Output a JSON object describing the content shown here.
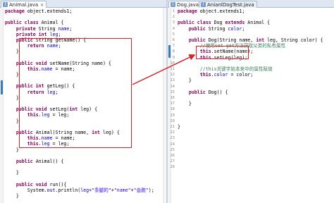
{
  "left_editor": {
    "tab_active": "Animal.java",
    "tab_inactive": "Dog.java",
    "lines": [
      [
        [
          "kw",
          "package"
        ],
        [
          "t",
          " object.extends1;"
        ]
      ],
      [],
      [
        [
          "kw",
          "public class"
        ],
        [
          "t",
          " Animal {"
        ]
      ],
      [
        [
          "t",
          "    "
        ],
        [
          "kw",
          "private"
        ],
        [
          "t",
          " String "
        ],
        [
          "fld",
          "name"
        ],
        [
          "t",
          ";"
        ]
      ],
      [
        [
          "t",
          "    "
        ],
        [
          "kw",
          "private int"
        ],
        [
          "t",
          " "
        ],
        [
          "fld",
          "leg"
        ],
        [
          "t",
          ";"
        ]
      ],
      [
        [
          "t",
          "    "
        ],
        [
          "kw",
          "public"
        ],
        [
          "t",
          " String getName() {"
        ]
      ],
      [
        [
          "t",
          "        "
        ],
        [
          "kw",
          "return"
        ],
        [
          "t",
          " "
        ],
        [
          "fld",
          "name"
        ],
        [
          "t",
          ";"
        ]
      ],
      [
        [
          "t",
          "    }"
        ]
      ],
      [],
      [
        [
          "t",
          "    "
        ],
        [
          "kw",
          "public void"
        ],
        [
          "t",
          " setName(String name) {"
        ]
      ],
      [
        [
          "t",
          "        "
        ],
        [
          "kw",
          "this"
        ],
        [
          "t",
          "."
        ],
        [
          "fld",
          "name"
        ],
        [
          "t",
          " = name;"
        ]
      ],
      [
        [
          "t",
          "    }"
        ]
      ],
      [],
      [
        [
          "t",
          "    "
        ],
        [
          "kw",
          "public int"
        ],
        [
          "t",
          " getLeg() {"
        ]
      ],
      [
        [
          "t",
          "        "
        ],
        [
          "kw",
          "return"
        ],
        [
          "t",
          " "
        ],
        [
          "fld",
          "leg"
        ],
        [
          "t",
          ";"
        ]
      ],
      [
        [
          "t",
          "    }"
        ]
      ],
      [],
      [
        [
          "t",
          "    "
        ],
        [
          "kw",
          "public void"
        ],
        [
          "t",
          " setLeg("
        ],
        [
          "kw",
          "int"
        ],
        [
          "t",
          " leg) {"
        ]
      ],
      [
        [
          "t",
          "        "
        ],
        [
          "kw",
          "this"
        ],
        [
          "t",
          "."
        ],
        [
          "fld",
          "leg"
        ],
        [
          "t",
          " = leg;"
        ]
      ],
      [
        [
          "t",
          "    }"
        ]
      ],
      [],
      [
        [
          "t",
          "    "
        ],
        [
          "kw",
          "public"
        ],
        [
          "t",
          " Animal(String name, "
        ],
        [
          "kw",
          "int"
        ],
        [
          "t",
          " leg) {"
        ]
      ],
      [
        [
          "t",
          "        "
        ],
        [
          "kw",
          "this"
        ],
        [
          "t",
          "."
        ],
        [
          "fld",
          "name"
        ],
        [
          "t",
          " = name;"
        ]
      ],
      [
        [
          "t",
          "        "
        ],
        [
          "kw",
          "this"
        ],
        [
          "t",
          "."
        ],
        [
          "fld",
          "leg"
        ],
        [
          "t",
          " = leg;"
        ]
      ],
      [
        [
          "t",
          "    }"
        ]
      ],
      [],
      [
        [
          "t",
          "    "
        ],
        [
          "kw",
          "public"
        ],
        [
          "t",
          " Animal() {"
        ]
      ],
      [],
      [
        [
          "t",
          "    }"
        ]
      ],
      [],
      [
        [
          "t",
          "    "
        ],
        [
          "kw",
          "public void"
        ],
        [
          "t",
          " run(){"
        ]
      ],
      [
        [
          "t",
          "        System."
        ],
        [
          "fld",
          "out"
        ],
        [
          "t",
          ".println("
        ],
        [
          "fld",
          "leg"
        ],
        [
          "t",
          "+"
        ],
        [
          "str",
          "\"条腿的\""
        ],
        [
          "t",
          "+"
        ],
        [
          "str",
          "\"name\""
        ],
        [
          "t",
          "+"
        ],
        [
          "str",
          "\"会跑\""
        ],
        [
          "t",
          ");"
        ]
      ],
      [
        [
          "t",
          "    }"
        ]
      ]
    ]
  },
  "right_editor": {
    "tab_active": "Dog.java",
    "tab_inactive": "AnianlDogTest.java",
    "line_numbers": [
      "1",
      "2",
      "3",
      "4",
      "5",
      "6",
      "7",
      "8",
      "9",
      "10",
      "11",
      "12",
      "13",
      "14",
      "15",
      "16",
      "17",
      "18",
      "19",
      "20",
      "21",
      "22",
      "23",
      "24",
      "25",
      "26",
      "27",
      "28"
    ],
    "lines": [
      [
        [
          "kw",
          "package"
        ],
        [
          "t",
          " object.extends1;"
        ]
      ],
      [],
      [
        [
          "kw",
          "public class"
        ],
        [
          "t",
          " Dog "
        ],
        [
          "kw",
          "extends"
        ],
        [
          "t",
          " Animal {"
        ]
      ],
      [
        [
          "t",
          "    "
        ],
        [
          "kw",
          "public"
        ],
        [
          "t",
          " String "
        ],
        [
          "fld",
          "color"
        ],
        [
          "t",
          ";"
        ]
      ],
      [],
      [
        [
          "t",
          "    "
        ],
        [
          "kw",
          "public"
        ],
        [
          "t",
          " Dog(String name, "
        ],
        [
          "kw",
          "int"
        ],
        [
          "t",
          " leg, String color) {"
        ]
      ],
      [
        [
          "t",
          "        "
        ],
        [
          "cm",
          "//使用set get方法获取父类的私有属性"
        ]
      ],
      [
        [
          "t",
          "        "
        ],
        [
          "kw",
          "this"
        ],
        [
          "t",
          ".setName(name);"
        ]
      ],
      [
        [
          "t",
          "        "
        ],
        [
          "kw",
          "this"
        ],
        [
          "t",
          ".setLeg(leg);"
        ]
      ],
      [],
      [
        [
          "t",
          "        "
        ],
        [
          "cm",
          "//this关键字始本来中的属性赋值"
        ]
      ],
      [
        [
          "t",
          "        "
        ],
        [
          "kw",
          "this"
        ],
        [
          "t",
          "."
        ],
        [
          "fld",
          "color"
        ],
        [
          "t",
          " = color;"
        ]
      ],
      [
        [
          "t",
          "    }"
        ]
      ],
      [],
      [
        [
          "t",
          "    "
        ],
        [
          "kw",
          "public"
        ],
        [
          "t",
          " Dog() {"
        ]
      ],
      [],
      [
        [
          "t",
          "    }"
        ]
      ],
      [],
      [],
      [],
      [
        [
          "t",
          "}"
        ]
      ]
    ]
  },
  "colors": {
    "annotation_red": "#d2232a",
    "keyword": "#7f0055",
    "field": "#0000c0",
    "string": "#2a00ff",
    "comment": "#3f7f5f"
  }
}
